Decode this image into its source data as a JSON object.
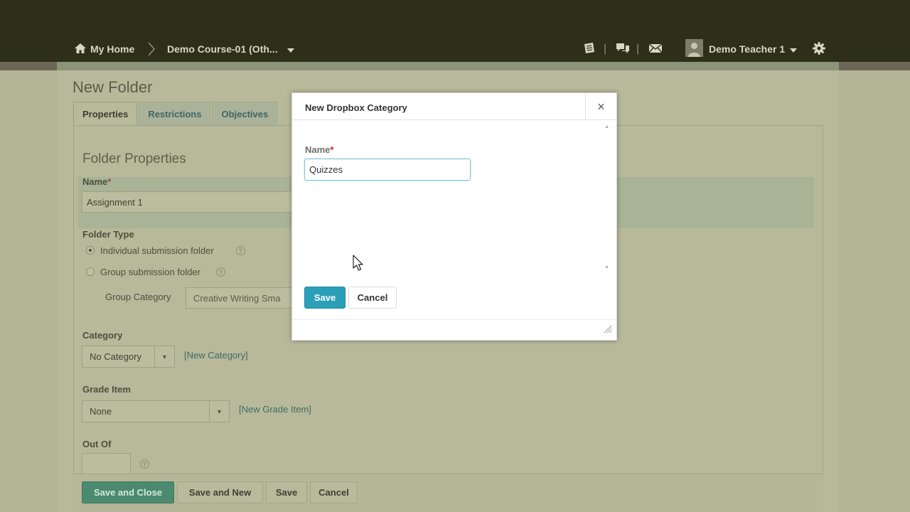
{
  "nav": {
    "home": "My Home",
    "course": "Demo Course-01 (Oth...",
    "user": "Demo Teacher 1",
    "icons": [
      "home-icon",
      "chevron-right-icon",
      "chevron-down-icon",
      "notebook-icon",
      "chat-icon",
      "mail-icon",
      "avatar",
      "gear-icon"
    ]
  },
  "page": {
    "title": "New Folder",
    "tabs": [
      {
        "label": "Properties",
        "active": true
      },
      {
        "label": "Restrictions",
        "active": false
      },
      {
        "label": "Objectives",
        "active": false
      }
    ],
    "section_title": "Folder Properties",
    "name_label": "Name",
    "name_value": "Assignment 1",
    "folder_type_label": "Folder Type",
    "folder_type_options": [
      {
        "label": "Individual submission folder",
        "selected": true
      },
      {
        "label": "Group submission folder",
        "selected": false
      }
    ],
    "group_category_label": "Group Category",
    "group_category_value": "Creative Writing Sma",
    "category_label": "Category",
    "category_value": "No Category",
    "new_category_link": "[New Category]",
    "grade_item_label": "Grade Item",
    "grade_item_value": "None",
    "new_grade_item_link": "[New Grade Item]",
    "out_of_label": "Out Of"
  },
  "footer": {
    "save_close": "Save and Close",
    "save_new": "Save and New",
    "save": "Save",
    "cancel": "Cancel"
  },
  "modal": {
    "title": "New Dropbox Category",
    "close": "×",
    "name_label": "Name",
    "required_mark": "*",
    "name_value": "Quizzes",
    "save": "Save",
    "cancel": "Cancel"
  },
  "colors": {
    "topbar": "#2e2f18",
    "primary_button": "#4b8a6f",
    "modal_save": "#2c9fb8",
    "input_focus": "#7fc5d8"
  }
}
